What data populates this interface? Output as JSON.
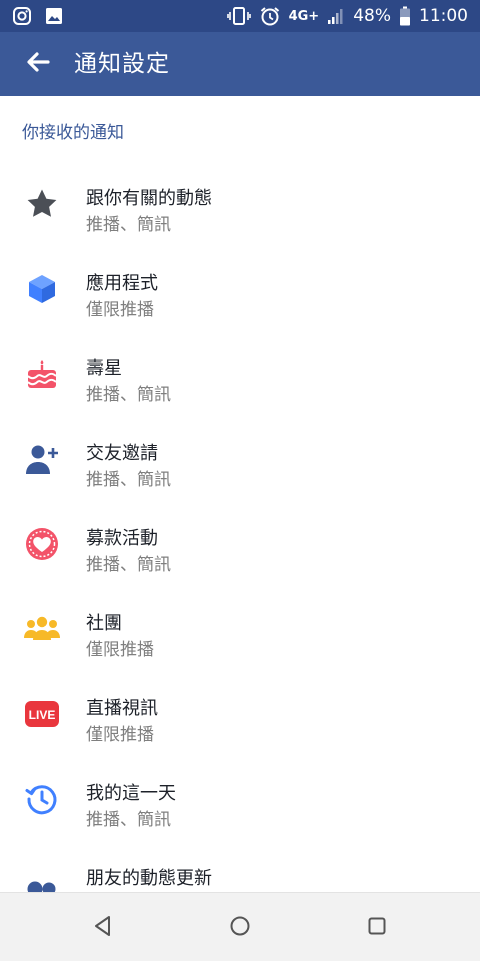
{
  "status_bar": {
    "network": "4G+",
    "battery": "48%",
    "time": "11:00",
    "icons": [
      "instagram-icon",
      "gallery-icon",
      "vibrate-icon",
      "alarm-icon",
      "signal-icon",
      "battery-icon"
    ]
  },
  "app_bar": {
    "title": "通知設定",
    "back_icon": "back-arrow-icon"
  },
  "section_header": "你接收的通知",
  "items": [
    {
      "icon": "star-icon",
      "label": "跟你有關的動態",
      "sub": "推播、簡訊",
      "color": "#4b4f56"
    },
    {
      "icon": "cube-icon",
      "label": "應用程式",
      "sub": "僅限推播",
      "color": "#4080ff"
    },
    {
      "icon": "birthday-cake-icon",
      "label": "壽星",
      "sub": "推播、簡訊",
      "color": "#f35369"
    },
    {
      "icon": "add-friend-icon",
      "label": "交友邀請",
      "sub": "推播、簡訊",
      "color": "#3b5998"
    },
    {
      "icon": "fundraiser-heart-icon",
      "label": "募款活動",
      "sub": "推播、簡訊",
      "color": "#f35369"
    },
    {
      "icon": "groups-icon",
      "label": "社團",
      "sub": "僅限推播",
      "color": "#f7b928"
    },
    {
      "icon": "live-video-icon",
      "label": "直播視訊",
      "sub": "僅限推播",
      "color": "#e9363d",
      "badge": "LIVE"
    },
    {
      "icon": "on-this-day-icon",
      "label": "我的這一天",
      "sub": "推播、簡訊",
      "color": "#4080ff"
    },
    {
      "icon": "friends-updates-icon",
      "label": "朋友的動態更新",
      "sub": "",
      "color": "#3b5998"
    }
  ],
  "nav_bar": {
    "buttons": [
      "back-triangle-icon",
      "home-circle-icon",
      "recents-square-icon"
    ]
  },
  "colors": {
    "status_bar": "#2d4886",
    "app_bar": "#3b5998",
    "nav_bar": "#f2f2f2"
  }
}
